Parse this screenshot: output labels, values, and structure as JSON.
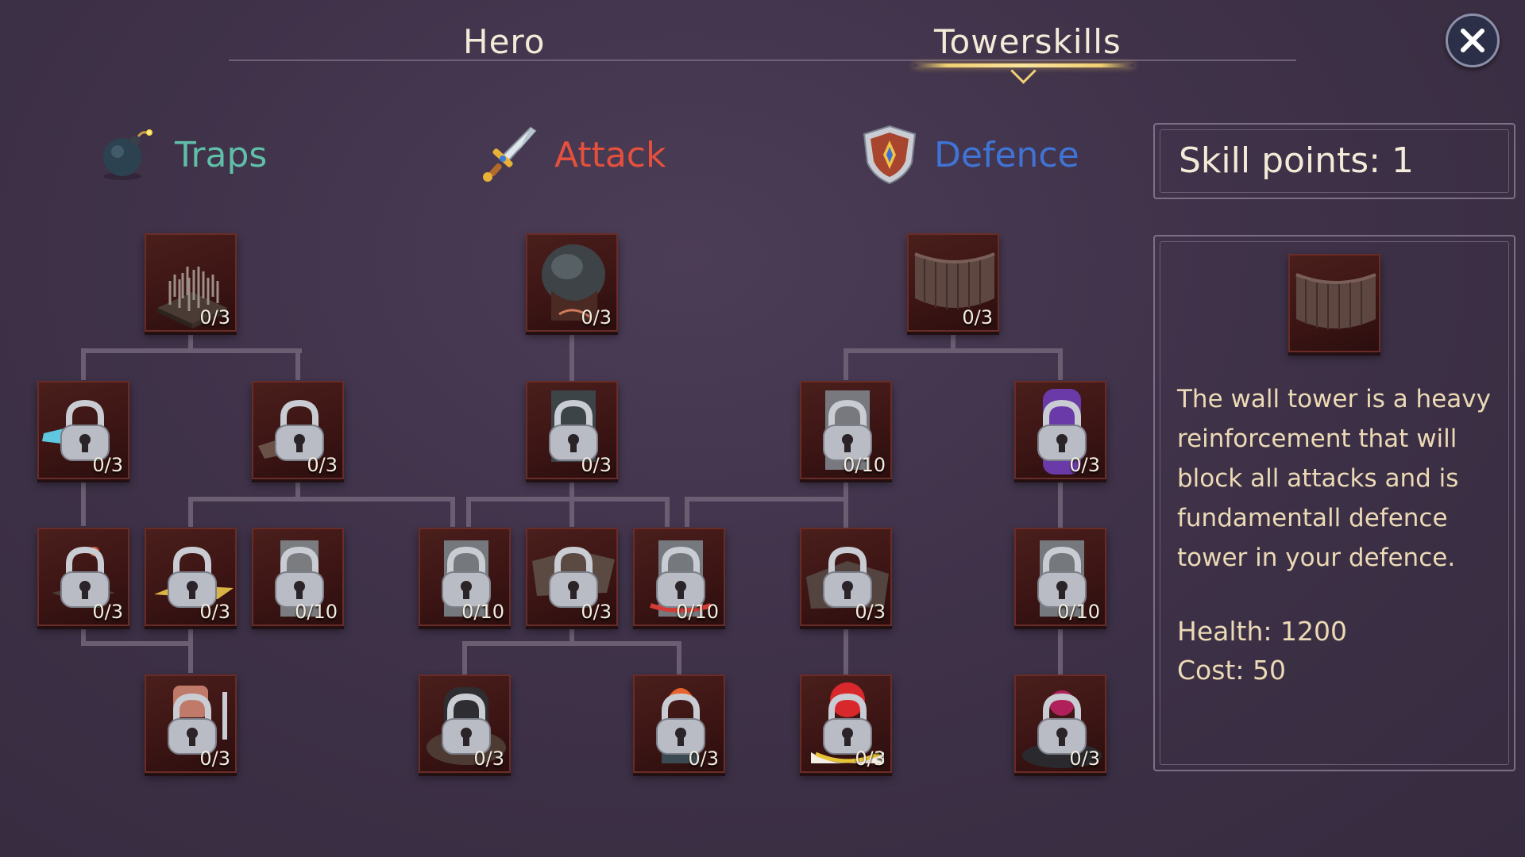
{
  "tabs": {
    "hero_label": "Hero",
    "towerskills_label": "Towerskills",
    "active": "Towerskills"
  },
  "close_icon": "close-icon",
  "categories": {
    "traps": {
      "label": "Traps",
      "icon": "bomb-icon",
      "color": "#5fbfa8"
    },
    "attack": {
      "label": "Attack",
      "icon": "sword-icon",
      "color": "#e5503c"
    },
    "defence": {
      "label": "Defence",
      "icon": "shield-icon",
      "color": "#3f74d6"
    }
  },
  "skill_points": {
    "label": "Skill points: 1"
  },
  "nodes": {
    "traps_root": {
      "count": "0/3",
      "icon": "spike-trap-icon",
      "locked": false
    },
    "traps_l2a": {
      "count": "0/3",
      "icon": "lock-icon",
      "locked": true
    },
    "traps_l2b": {
      "count": "0/3",
      "icon": "lock-icon",
      "locked": true
    },
    "traps_l3a": {
      "count": "0/3",
      "icon": "lock-icon",
      "locked": true
    },
    "traps_l3b": {
      "count": "0/3",
      "icon": "lock-icon",
      "locked": true
    },
    "traps_l3c": {
      "count": "0/10",
      "icon": "lock-icon",
      "locked": true
    },
    "traps_l4": {
      "count": "0/3",
      "icon": "lock-icon",
      "locked": true
    },
    "attack_root": {
      "count": "0/3",
      "icon": "stone-tower-icon",
      "locked": false
    },
    "attack_l2": {
      "count": "0/3",
      "icon": "lock-icon",
      "locked": true
    },
    "attack_l3a": {
      "count": "0/10",
      "icon": "lock-icon",
      "locked": true
    },
    "attack_l3b": {
      "count": "0/3",
      "icon": "lock-icon",
      "locked": true
    },
    "attack_l3c": {
      "count": "0/10",
      "icon": "lock-icon",
      "locked": true
    },
    "attack_l4a": {
      "count": "0/3",
      "icon": "lock-icon",
      "locked": true
    },
    "attack_l4b": {
      "count": "0/3",
      "icon": "lock-icon",
      "locked": true
    },
    "defence_root": {
      "count": "0/3",
      "icon": "wall-icon",
      "locked": false
    },
    "defence_l2a": {
      "count": "0/10",
      "icon": "lock-icon",
      "locked": true
    },
    "defence_l2b": {
      "count": "0/3",
      "icon": "lock-icon",
      "locked": true
    },
    "defence_l3a": {
      "count": "0/3",
      "icon": "lock-icon",
      "locked": true
    },
    "defence_l3b": {
      "count": "0/10",
      "icon": "lock-icon",
      "locked": true
    },
    "defence_l4a": {
      "count": "0/3",
      "icon": "lock-icon",
      "locked": true
    },
    "defence_l4b": {
      "count": "0/3",
      "icon": "lock-icon",
      "locked": true
    }
  },
  "info": {
    "image_icon": "wall-icon",
    "description": "The wall tower is a heavy reinforcement that will block all attacks and is fundamentall defence tower in your defence.",
    "health": "Health: 1200",
    "cost": "Cost: 50"
  }
}
